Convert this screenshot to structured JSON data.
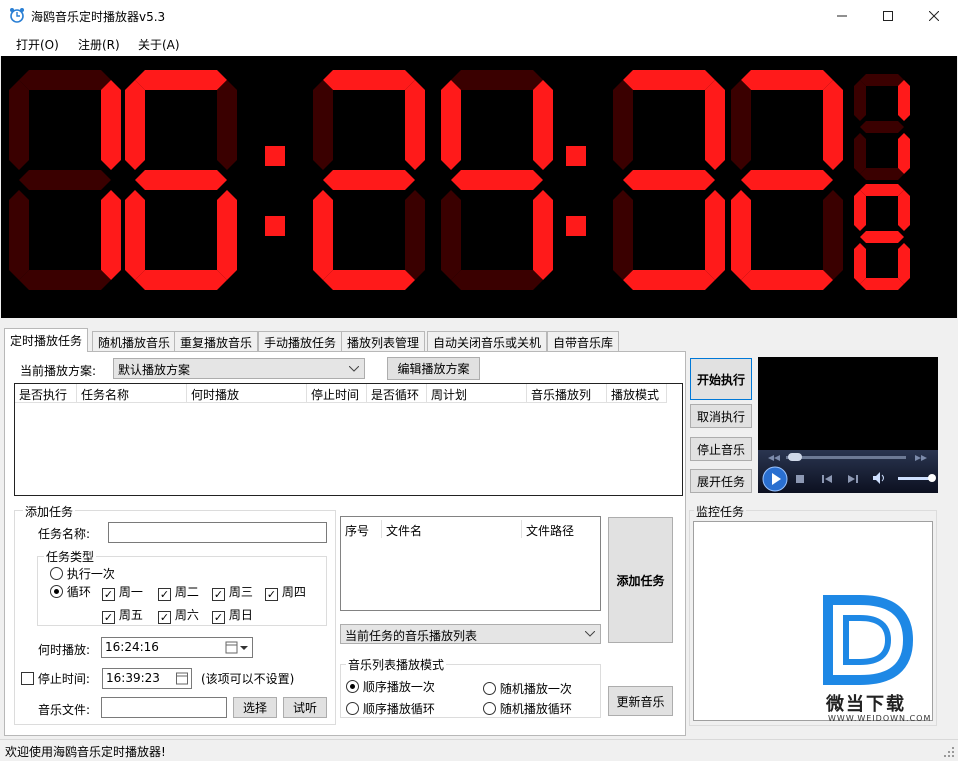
{
  "window": {
    "title": "海鸥音乐定时播放器v5.3"
  },
  "menu": [
    "打开(O)",
    "注册(R)",
    "关于(A)"
  ],
  "clock": {
    "time": "16:24:32",
    "on_color": "#ff1a1a",
    "off_color": "#3a0000"
  },
  "tabs": [
    "定时播放任务",
    "随机播放音乐",
    "重复播放音乐",
    "手动播放任务",
    "播放列表管理",
    "自动关闭音乐或关机",
    "自带音乐库"
  ],
  "scheme": {
    "label": "当前播放方案:",
    "value": "默认播放方案",
    "edit_button": "编辑播放方案"
  },
  "task_table": {
    "columns": [
      "是否执行",
      "任务名称",
      "何时播放",
      "停止时间",
      "是否循环",
      "周计划",
      "音乐播放列",
      "播放模式"
    ]
  },
  "add_task": {
    "title": "添加任务",
    "name_label": "任务名称:",
    "name_value": "",
    "type_group": "任务类型",
    "once_label": "执行一次",
    "loop_label": "循环",
    "days": [
      "周一",
      "周二",
      "周三",
      "周四",
      "周五",
      "周六",
      "周日"
    ],
    "when_label": "何时播放:",
    "when_value": "16:24:16",
    "stop_label": "停止时间:",
    "stop_value": "16:39:23",
    "stop_note": "(该项可以不设置)",
    "file_label": "音乐文件:",
    "file_value": "",
    "choose_button": "选择",
    "try_button": "试听"
  },
  "file_table": {
    "columns": [
      "序号",
      "文件名",
      "文件路径"
    ]
  },
  "playlist_select": "当前任务的音乐播放列表",
  "add_task_button": "添加任务",
  "play_mode": {
    "title": "音乐列表播放模式",
    "options": [
      "顺序播放一次",
      "随机播放一次",
      "顺序播放循环",
      "随机播放循环"
    ]
  },
  "update_music_button": "更新音乐",
  "right_buttons": [
    "开始执行",
    "取消执行",
    "停止音乐",
    "展开任务"
  ],
  "monitor": {
    "title": "监控任务"
  },
  "watermark": {
    "brand": "微当下载",
    "url": "WWW.WEIDOWN.COM",
    "color": "#1e88e5"
  },
  "status": "欢迎使用海鸥音乐定时播放器!"
}
